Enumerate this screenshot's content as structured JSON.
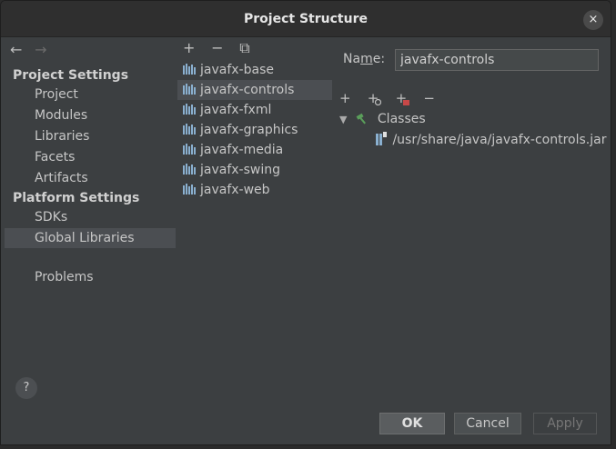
{
  "dialog": {
    "title": "Project Structure",
    "close_icon": "×"
  },
  "nav": {
    "back": "←",
    "forward": "→"
  },
  "sidebar": {
    "project_heading": "Project Settings",
    "project_items": [
      "Project",
      "Modules",
      "Libraries",
      "Facets",
      "Artifacts"
    ],
    "platform_heading": "Platform Settings",
    "platform_items": [
      "SDKs",
      "Global Libraries"
    ],
    "problems": "Problems",
    "selected": "Global Libraries"
  },
  "libraries": {
    "toolbar": {
      "add": "+",
      "remove": "−",
      "copy": "⧉"
    },
    "items": [
      "javafx-base",
      "javafx-controls",
      "javafx-fxml",
      "javafx-graphics",
      "javafx-media",
      "javafx-swing",
      "javafx-web"
    ],
    "selected": "javafx-controls"
  },
  "details": {
    "name_label_pre": "Na",
    "name_label_u": "m",
    "name_label_post": "e:",
    "name_value": "javafx-controls",
    "toolbar": {
      "add": "+",
      "remove": "−"
    },
    "tree": {
      "root": "Classes",
      "child": "/usr/share/java/javafx-controls.jar"
    }
  },
  "buttons": {
    "help": "?",
    "ok": "OK",
    "cancel": "Cancel",
    "apply": "Apply"
  },
  "colors": {
    "accent_green": "#5a9e5a",
    "library_icon": "#8ab0d0",
    "remove_red": "#c74848"
  }
}
